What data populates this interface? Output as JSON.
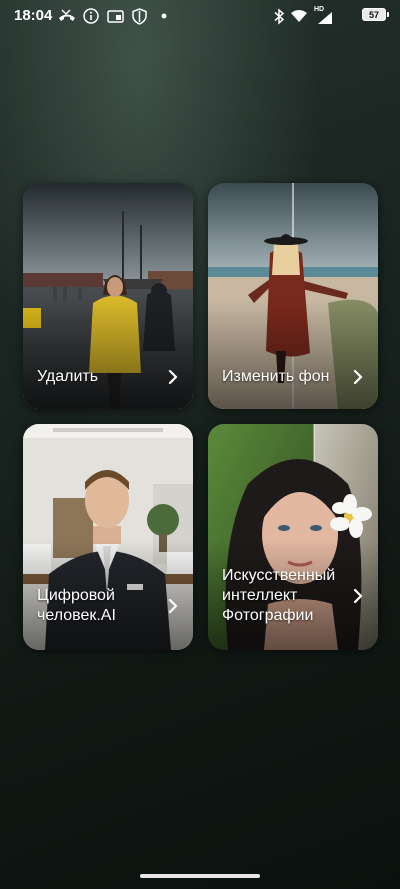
{
  "status_bar": {
    "time": "18:04",
    "battery_level": "57",
    "network_label": "HD",
    "icons": [
      "missed-call-icon",
      "info-icon",
      "cast-icon",
      "shield-icon",
      "dot-icon",
      "bluetooth-icon",
      "wifi-icon",
      "signal-icon",
      "battery-icon"
    ]
  },
  "cards": [
    {
      "label": "Удалить",
      "scene": "harbor-woman-yellow-raincoat"
    },
    {
      "label": "Изменить фон",
      "scene": "woman-hat-beach-split"
    },
    {
      "label": "Цифровой человек.AI",
      "scene": "man-suit-office"
    },
    {
      "label": "Искусственный интеллект Фотографии",
      "scene": "woman-portrait-anime-split"
    }
  ],
  "colors": {
    "background": "#1a2521",
    "card_text": "#ffffff"
  }
}
